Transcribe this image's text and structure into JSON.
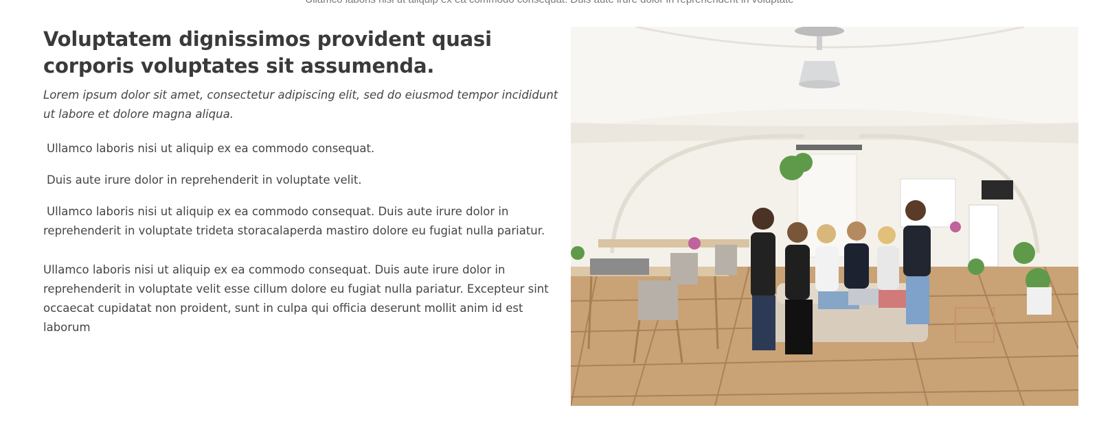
{
  "about": {
    "cutoff_text": "Ullamco laboris nisi ut aliquip ex ea commodo consequat. Duis aute irure dolor in reprehenderit in voluptate",
    "title": "Voluptatem dignissimos provident quasi corporis voluptates sit assumenda.",
    "lead": "Lorem ipsum dolor sit amet, consectetur adipiscing elit, sed do eiusmod tempor incididunt ut labore et dolore magna aliqua.",
    "items": [
      "Ullamco laboris nisi ut aliquip ex ea commodo consequat.",
      "Duis aute irure dolor in reprehenderit in voluptate velit.",
      "Ullamco laboris nisi ut aliquip ex ea commodo consequat. Duis aute irure dolor in reprehenderit in voluptate trideta storacalaperda mastiro dolore eu fugiat nulla pariatur."
    ],
    "paragraph": "Ullamco laboris nisi ut aliquip ex ea commodo consequat. Duis aute irure dolor in reprehenderit in voluptate velit esse cillum dolore eu fugiat nulla pariatur. Excepteur sint occaecat cupidatat non proident, sunt in culpa qui officia deserunt mollit anim id est laborum"
  },
  "colors": {
    "heading": "#3a3a3a",
    "text": "#444444",
    "floor": "#c39a6b",
    "wall": "#f6f3ea"
  }
}
